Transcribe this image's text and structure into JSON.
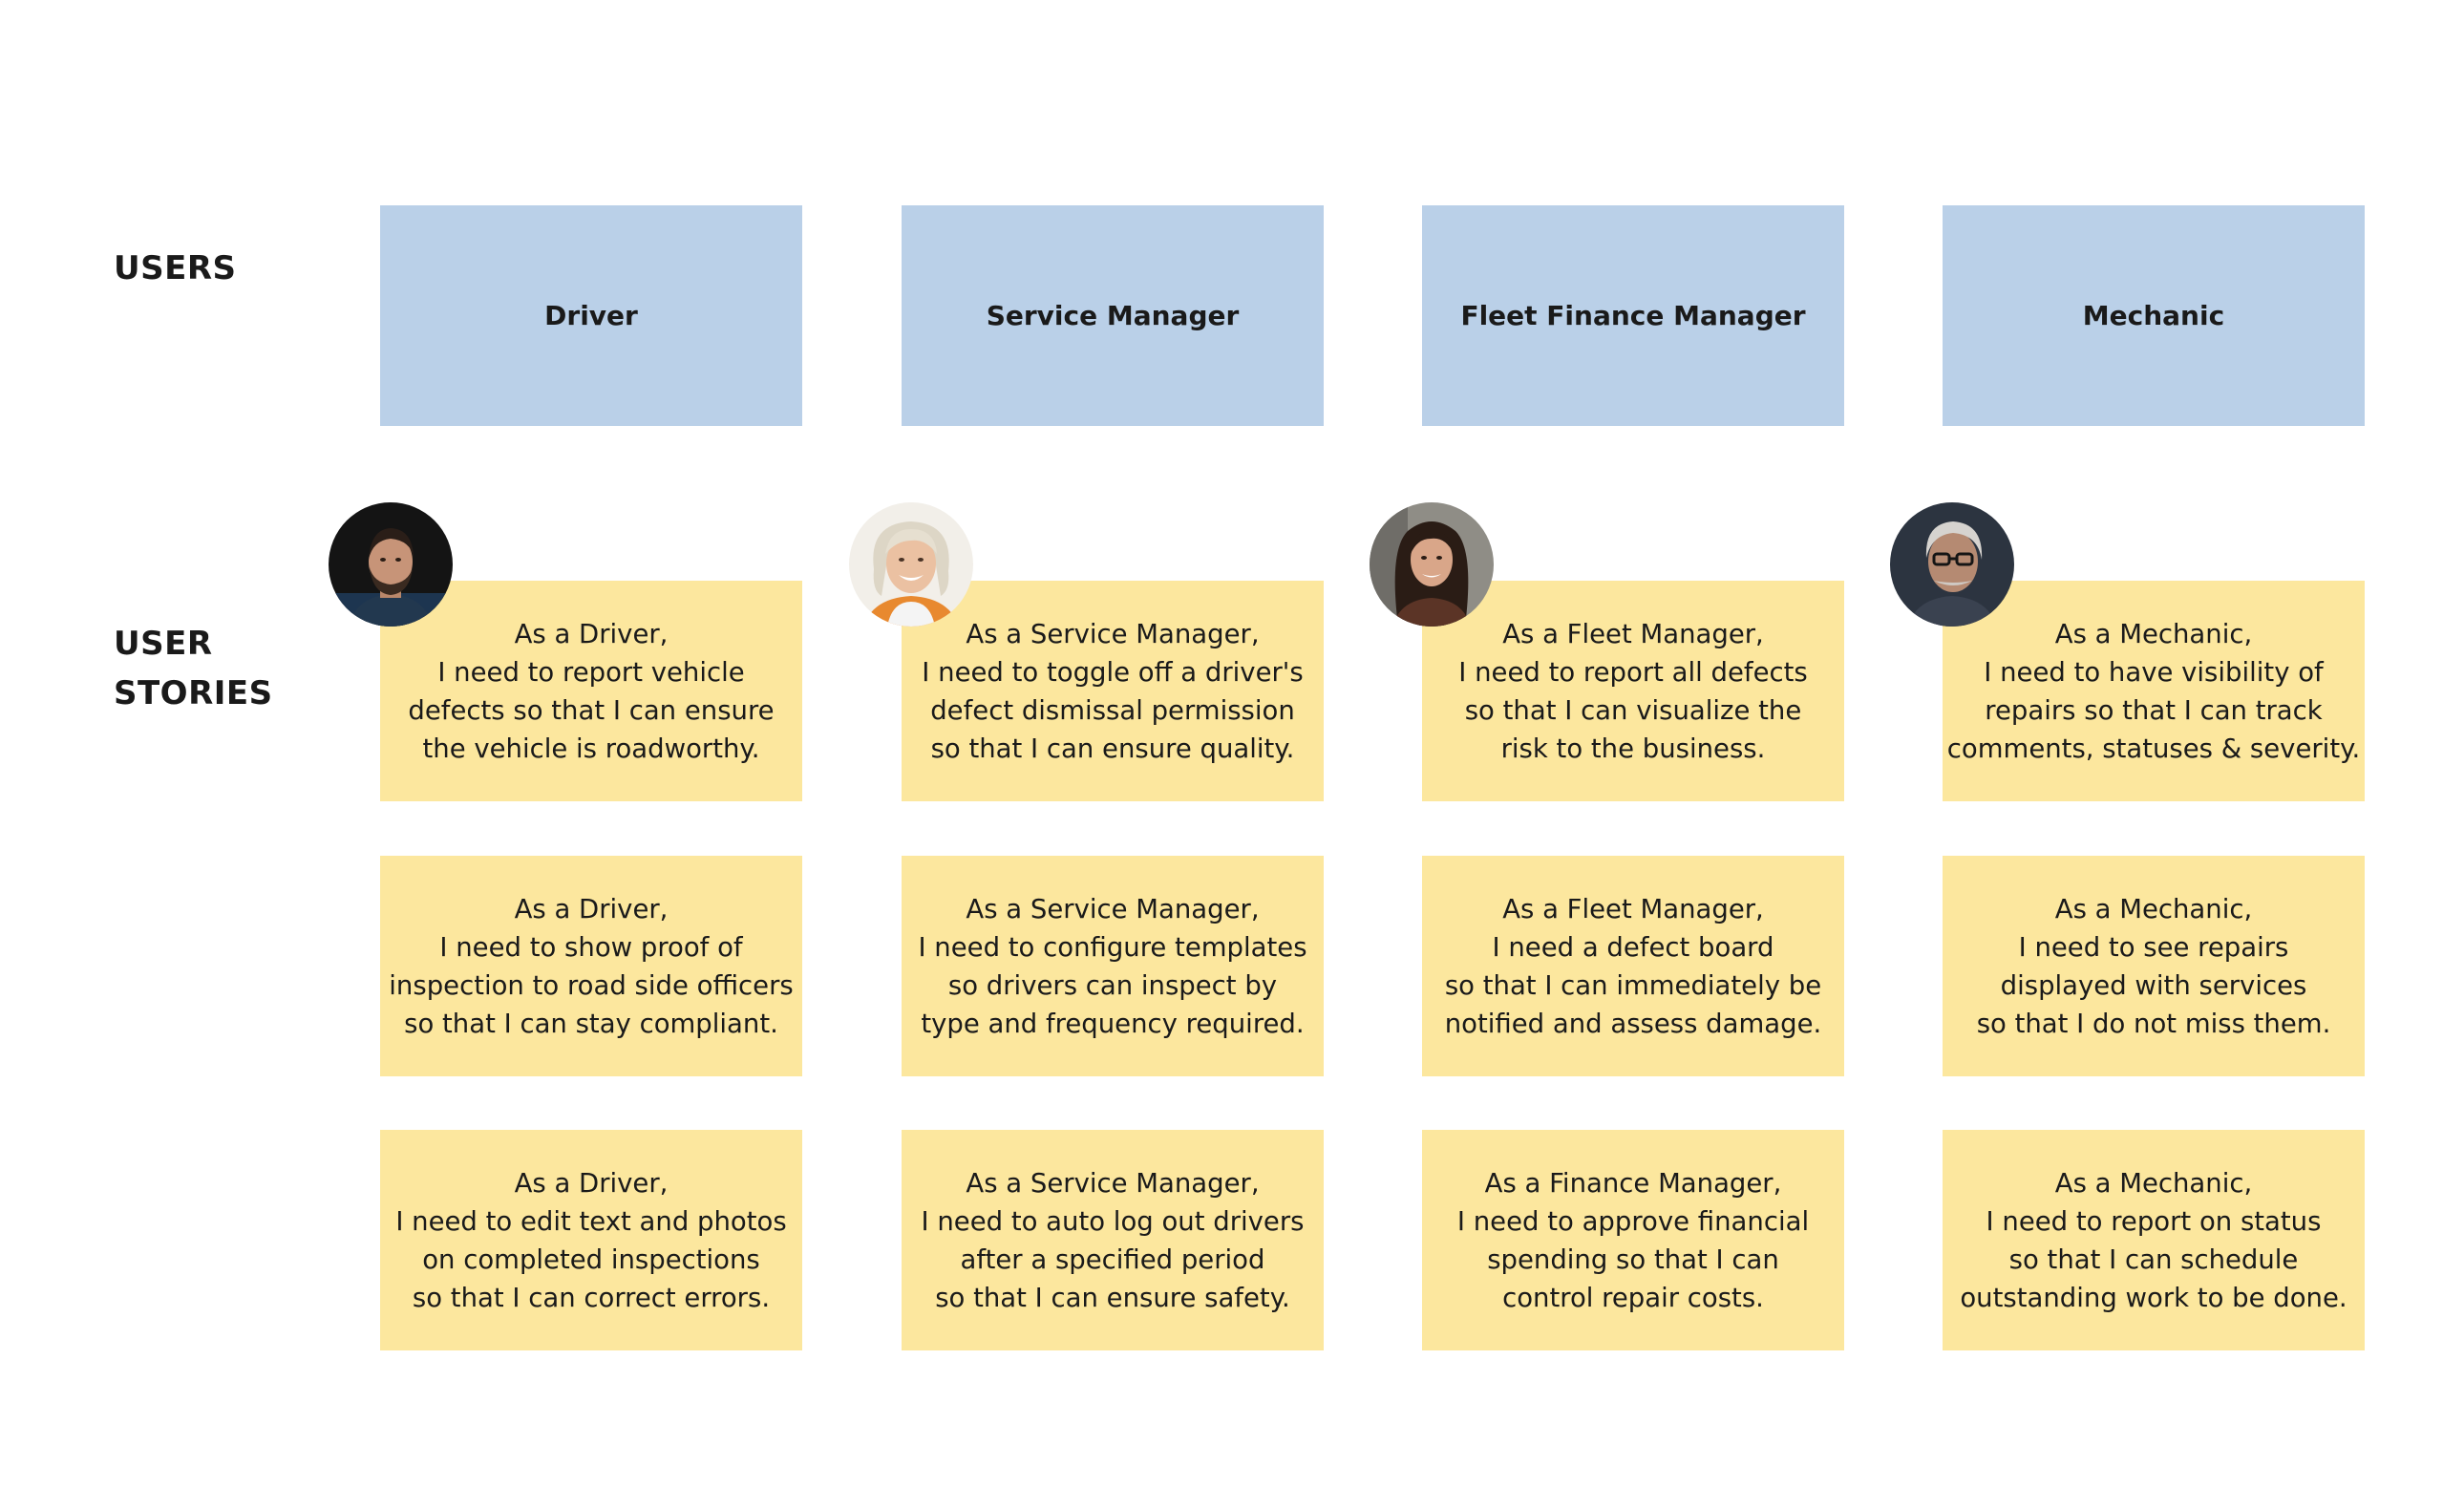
{
  "rows": {
    "users_label": "USERS",
    "stories_label": "USER\nSTORIES"
  },
  "users": [
    {
      "name": "Driver",
      "avatar": "driver-avatar"
    },
    {
      "name": "Service Manager",
      "avatar": "service-manager-avatar"
    },
    {
      "name": "Fleet Finance Manager",
      "avatar": "fleet-finance-manager-avatar"
    },
    {
      "name": "Mechanic",
      "avatar": "mechanic-avatar"
    }
  ],
  "stories": [
    [
      "As a Driver,\nI need to report vehicle\ndefects so that I can ensure\nthe vehicle is roadworthy.",
      "As a Driver,\nI need to show proof of\ninspection to road side officers\nso that I can stay compliant.",
      "As a Driver,\nI need to edit text and photos\non completed inspections\nso that I can correct errors."
    ],
    [
      "As a Service Manager,\nI need to toggle off a driver's\ndefect dismissal permission\nso that I can ensure quality.",
      "As a Service Manager,\nI need to configure templates\nso drivers can inspect by\ntype and frequency required.",
      "As a Service Manager,\nI need to auto log out drivers\nafter a specified period\nso that I can ensure safety."
    ],
    [
      "As a Fleet Manager,\nI need to report all defects\nso that I can visualize the\nrisk to the business.",
      "As a Fleet Manager,\nI need a defect board\nso that I can immediately be\nnotified and assess damage.",
      "As a Finance Manager,\nI need to approve financial\nspending so that I can\ncontrol repair costs."
    ],
    [
      "As a Mechanic,\nI need to have visibility of\nrepairs so that I can track\ncomments, statuses & severity.",
      "As a Mechanic,\nI need to see repairs\ndisplayed with services\nso that I do not miss them.",
      "As a Mechanic,\nI need to report on status\nso that I can schedule\noutstanding work to be done."
    ]
  ],
  "colors": {
    "user_card": "#bad0e8",
    "story_card": "#fce79e",
    "text": "#1a1a1a"
  }
}
